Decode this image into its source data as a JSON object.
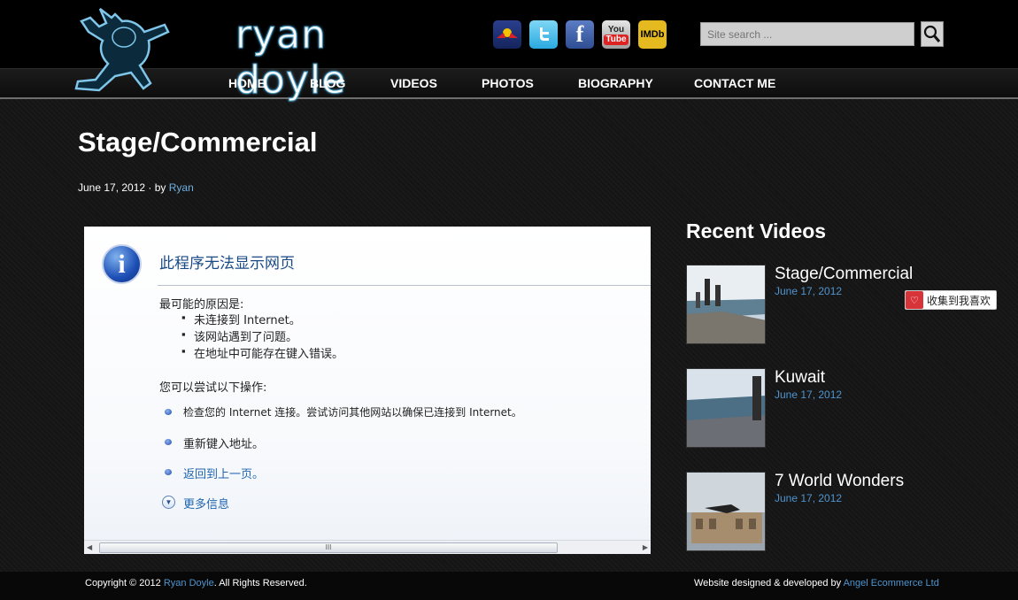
{
  "site": {
    "logo_text": "ryan doyle"
  },
  "nav": {
    "items": [
      {
        "label": "HOME"
      },
      {
        "label": "BLOG"
      },
      {
        "label": "VIDEOS"
      },
      {
        "label": "PHOTOS"
      },
      {
        "label": "BIOGRAPHY"
      },
      {
        "label": "CONTACT ME"
      }
    ]
  },
  "social": {
    "icons": [
      "redbull-icon",
      "twitter-icon",
      "facebook-icon",
      "youtube-icon",
      "imdb-icon"
    ],
    "facebook_glyph": "f",
    "youtube_label_top": "You",
    "youtube_label_bottom": "Tube",
    "imdb_label": "IMDb"
  },
  "search": {
    "placeholder": "Site search ...",
    "icon": "search-icon"
  },
  "post": {
    "title": "Stage/Commercial",
    "date": "June 17, 2012",
    "separator": " · by ",
    "author": "Ryan"
  },
  "error_page": {
    "title": "此程序无法显示网页",
    "causes_heading": "最可能的原因是:",
    "causes": [
      "未连接到 Internet。",
      "该网站遇到了问题。",
      "在地址中可能存在键入错误。"
    ],
    "actions_heading": "您可以尝试以下操作:",
    "actions": [
      "检查您的 Internet 连接。尝试访问其他网站以确保已连接到 Internet。",
      "重新键入地址。",
      "返回到上一页。"
    ],
    "more_info": "更多信息",
    "scroll_grip": "III"
  },
  "sidebar": {
    "title": "Recent Videos",
    "videos": [
      {
        "title": "Stage/Commercial",
        "date": "June 17, 2012"
      },
      {
        "title": "Kuwait",
        "date": "June 17, 2012"
      },
      {
        "title": "7 World Wonders",
        "date": "June 17, 2012"
      }
    ]
  },
  "favorite_button": {
    "label": "收集到我喜欢"
  },
  "footer": {
    "copyright_prefix": "Copyright © 2012 ",
    "copyright_name": "Ryan Doyle",
    "copyright_suffix": ". All Rights Reserved.",
    "credit_prefix": "Website designed & developed by ",
    "credit_company": "Angel Ecommerce Ltd"
  },
  "colors": {
    "link": "#4f94cf",
    "accent_logo": "#4a9cc6",
    "background": "#151515"
  }
}
